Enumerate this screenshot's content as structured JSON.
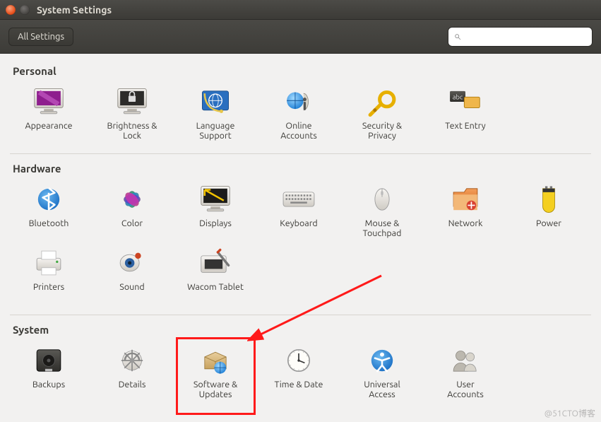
{
  "window": {
    "title": "System Settings"
  },
  "toolbar": {
    "all_settings": "All Settings",
    "search_placeholder": ""
  },
  "sections": {
    "personal": {
      "title": "Personal",
      "items": [
        {
          "id": "appearance",
          "label": "Appearance",
          "icon": "appearance-icon"
        },
        {
          "id": "brightness",
          "label": "Brightness &\nLock",
          "icon": "brightness-lock-icon"
        },
        {
          "id": "language",
          "label": "Language\nSupport",
          "icon": "language-icon"
        },
        {
          "id": "online-accounts",
          "label": "Online\nAccounts",
          "icon": "online-accounts-icon"
        },
        {
          "id": "security",
          "label": "Security &\nPrivacy",
          "icon": "security-icon"
        },
        {
          "id": "text-entry",
          "label": "Text Entry",
          "icon": "text-entry-icon"
        }
      ]
    },
    "hardware": {
      "title": "Hardware",
      "items": [
        {
          "id": "bluetooth",
          "label": "Bluetooth",
          "icon": "bluetooth-icon"
        },
        {
          "id": "color",
          "label": "Color",
          "icon": "color-icon"
        },
        {
          "id": "displays",
          "label": "Displays",
          "icon": "displays-icon"
        },
        {
          "id": "keyboard",
          "label": "Keyboard",
          "icon": "keyboard-icon"
        },
        {
          "id": "mouse",
          "label": "Mouse &\nTouchpad",
          "icon": "mouse-icon"
        },
        {
          "id": "network",
          "label": "Network",
          "icon": "network-icon"
        },
        {
          "id": "power",
          "label": "Power",
          "icon": "power-icon"
        },
        {
          "id": "printers",
          "label": "Printers",
          "icon": "printers-icon"
        },
        {
          "id": "sound",
          "label": "Sound",
          "icon": "sound-icon"
        },
        {
          "id": "wacom",
          "label": "Wacom Tablet",
          "icon": "wacom-icon"
        }
      ]
    },
    "system": {
      "title": "System",
      "items": [
        {
          "id": "backups",
          "label": "Backups",
          "icon": "backups-icon"
        },
        {
          "id": "details",
          "label": "Details",
          "icon": "details-icon"
        },
        {
          "id": "software",
          "label": "Software &\nUpdates",
          "icon": "software-icon"
        },
        {
          "id": "time",
          "label": "Time & Date",
          "icon": "time-icon"
        },
        {
          "id": "universal",
          "label": "Universal\nAccess",
          "icon": "universal-access-icon"
        },
        {
          "id": "users",
          "label": "User\nAccounts",
          "icon": "users-icon"
        }
      ]
    }
  },
  "annotation": {
    "highlighted_item": "software",
    "arrow_color": "#ff1a1a"
  },
  "watermark": "@51CTO博客"
}
